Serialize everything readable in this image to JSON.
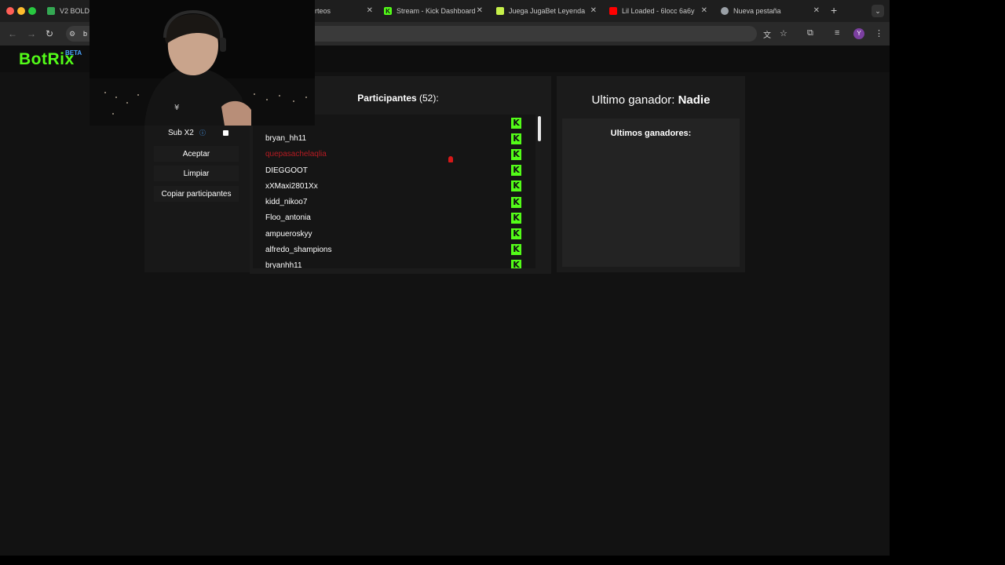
{
  "browser": {
    "tabs": [
      {
        "label": "V2 BOLD-",
        "favicon_color": "#34a853"
      },
      {
        "label": "rteos",
        "favicon_color": "#53fc18"
      },
      {
        "label": "Stream - Kick Dashboard",
        "favicon_color": "#53fc18"
      },
      {
        "label": "Juega JugaBet Leyenda",
        "favicon_color": "#c6f04a"
      },
      {
        "label": "Lil Loaded - 6locc 6a6y",
        "favicon_color": "#ff0000"
      },
      {
        "label": "Nueva pestaña",
        "favicon_color": "#9aa0a6"
      }
    ],
    "url": "b",
    "new_tab_symbol": "+",
    "profile_initial": "Y"
  },
  "app": {
    "logo": "BotRix",
    "badge": "BETA",
    "accent_color": "#53fc18"
  },
  "controls": {
    "sub_x2_label": "Sub X2",
    "sub_x2_info_icon": "info-icon",
    "sub_x2_checked": false,
    "buttons": [
      "Aceptar",
      "Limpiar",
      "Copiar participantes"
    ]
  },
  "participants": {
    "title": "Participantes",
    "count": "(52):",
    "names": [
      "bryan_hh11",
      "quepasachelaqlia",
      "DIEGGOOT",
      "xXMaxi2801Xx",
      "kidd_nikoo7",
      "Floo_antonia",
      "ampueroskyy",
      "alfredo_shampions",
      "bryanhh11"
    ],
    "highlighted_color": "#b51b22",
    "platform_badge": "K"
  },
  "winners": {
    "label": "Ultimo ganador:",
    "name": "Nadie",
    "list_title": "Ultimos ganadores:"
  }
}
